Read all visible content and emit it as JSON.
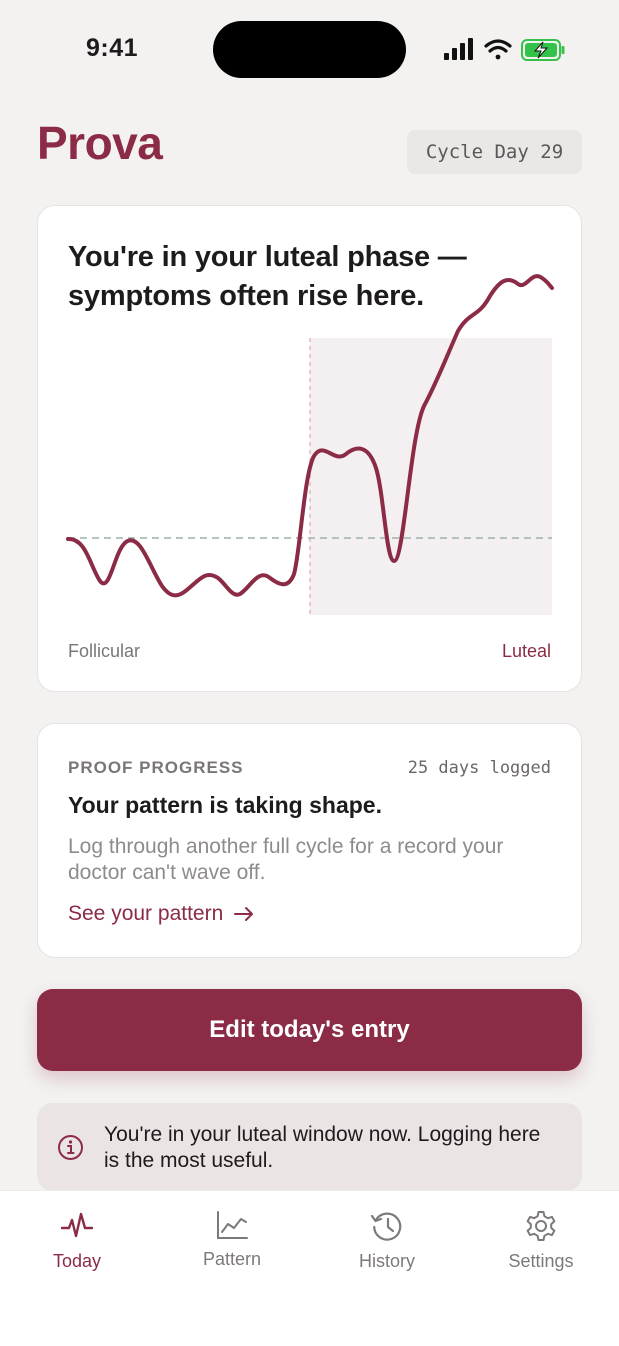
{
  "status_bar": {
    "time": "9:41"
  },
  "header": {
    "brand": "Prova",
    "cycle_day": "Cycle Day 29"
  },
  "phase_card": {
    "title": "You're in your luteal phase — symptoms often rise here.",
    "axis_left": "Follicular",
    "axis_right": "Luteal"
  },
  "proof_card": {
    "kicker": "PROOF PROGRESS",
    "days_logged": "25 days logged",
    "heading": "Your pattern is taking shape.",
    "body": "Log through another full cycle for a record your doctor can't wave off.",
    "link": "See your pattern"
  },
  "cta": {
    "label": "Edit today's entry"
  },
  "notice": {
    "text": "You're in your luteal window now. Logging here is the most useful."
  },
  "tabs": [
    {
      "label": "Today",
      "icon": "heartbeat-icon",
      "active": true
    },
    {
      "label": "Pattern",
      "icon": "chart-icon",
      "active": false
    },
    {
      "label": "History",
      "icon": "history-icon",
      "active": false
    },
    {
      "label": "Settings",
      "icon": "gear-icon",
      "active": false
    }
  ],
  "colors": {
    "accent": "#8b2b45",
    "background": "#f3f2f1",
    "luteal_band": "#f4eff0"
  }
}
